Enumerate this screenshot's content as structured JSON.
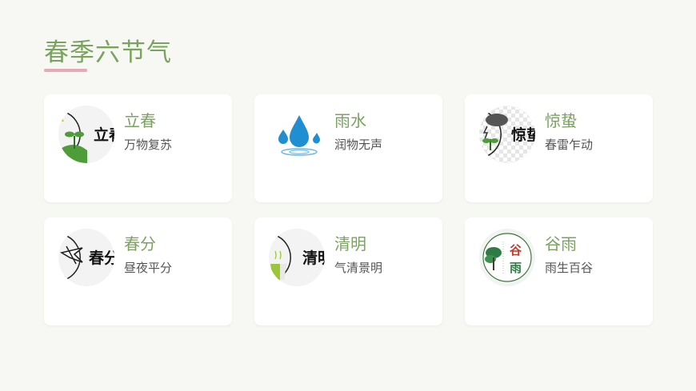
{
  "page": {
    "title": "春季六节气"
  },
  "cards": [
    {
      "term": "立春",
      "desc": "万物复苏",
      "icon": "sprout-icon",
      "badge": "立春"
    },
    {
      "term": "雨水",
      "desc": "润物无声",
      "icon": "raindrop-icon",
      "badge": ""
    },
    {
      "term": "惊蛰",
      "desc": "春雷乍动",
      "icon": "thunder-cloud-icon",
      "badge": "惊蛰"
    },
    {
      "term": "春分",
      "desc": "昼夜平分",
      "icon": "swallow-icon",
      "badge": "春分"
    },
    {
      "term": "清明",
      "desc": "气清景明",
      "icon": "teacup-icon",
      "badge": "清明"
    },
    {
      "term": "谷雨",
      "desc": "雨生百谷",
      "icon": "tree-seal-icon",
      "badge": "谷雨"
    }
  ],
  "colors": {
    "accent": "#7aa360",
    "underline": "#e8a8b5",
    "background": "#f7f8f3"
  }
}
